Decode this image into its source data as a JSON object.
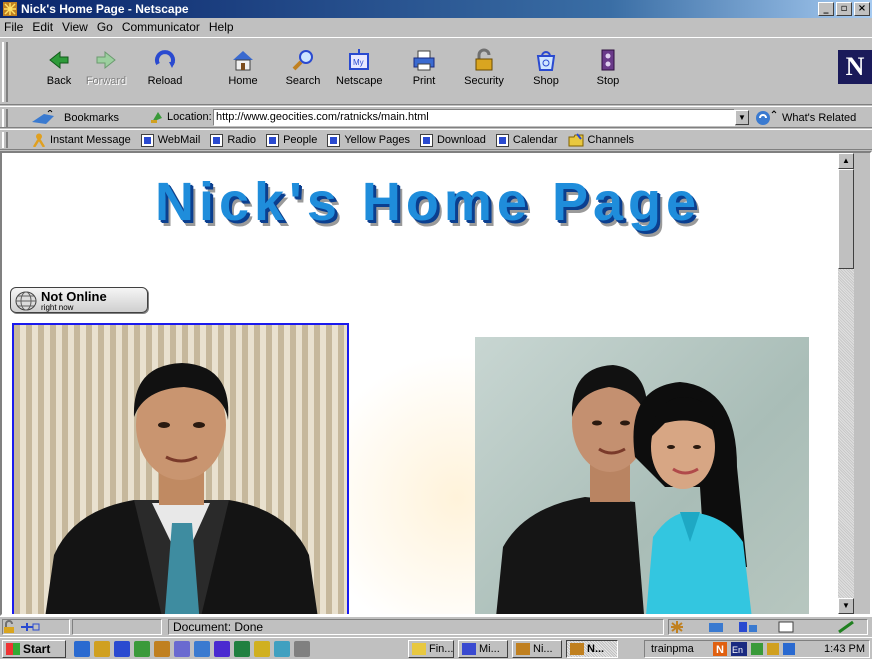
{
  "window": {
    "title": "Nick's Home Page - Netscape",
    "controls": [
      "_",
      "▫",
      "×"
    ]
  },
  "menu": [
    {
      "label": "File"
    },
    {
      "label": "Edit"
    },
    {
      "label": "View"
    },
    {
      "label": "Go"
    },
    {
      "label": "Communicator"
    },
    {
      "label": "Help"
    }
  ],
  "nav_toolbar": [
    {
      "label": "Back",
      "icon": "back-arrow-icon"
    },
    {
      "label": "Forward",
      "icon": "forward-arrow-icon",
      "disabled": true
    },
    {
      "label": "Reload",
      "icon": "reload-icon"
    },
    {
      "label": "Home",
      "icon": "home-icon"
    },
    {
      "label": "Search",
      "icon": "search-icon"
    },
    {
      "label": "Netscape",
      "icon": "netscape-icon"
    },
    {
      "label": "Print",
      "icon": "print-icon"
    },
    {
      "label": "Security",
      "icon": "security-lock-icon"
    },
    {
      "label": "Shop",
      "icon": "shop-icon"
    },
    {
      "label": "Stop",
      "icon": "stop-icon"
    }
  ],
  "location_bar": {
    "bookmarks_label": "Bookmarks",
    "location_label": "Location:",
    "url": "http://www.geocities.com/ratnicks/main.html",
    "whats_related_label": "What's Related"
  },
  "personal_toolbar": [
    {
      "label": "Instant Message"
    },
    {
      "label": "WebMail"
    },
    {
      "label": "Radio"
    },
    {
      "label": "People"
    },
    {
      "label": "Yellow Pages"
    },
    {
      "label": "Download"
    },
    {
      "label": "Calendar"
    },
    {
      "label": "Channels"
    }
  ],
  "page": {
    "heading": "Nick's Home Page",
    "status_indicator": {
      "main": "Not Online",
      "sub": "right now"
    }
  },
  "status_bar": {
    "text": "Document: Done"
  },
  "taskbar": {
    "start_label": "Start",
    "tasks": [
      {
        "label": "Fin..."
      },
      {
        "label": "Mi..."
      },
      {
        "label": "Ni..."
      },
      {
        "label": "N...",
        "active": true
      }
    ],
    "tray_label": "trainpma",
    "clock": "1:43 PM"
  },
  "colors": {
    "title_bar": "#0a246a",
    "heading_blue": "#1f8ddb",
    "photo_border": "#1a1aee"
  }
}
